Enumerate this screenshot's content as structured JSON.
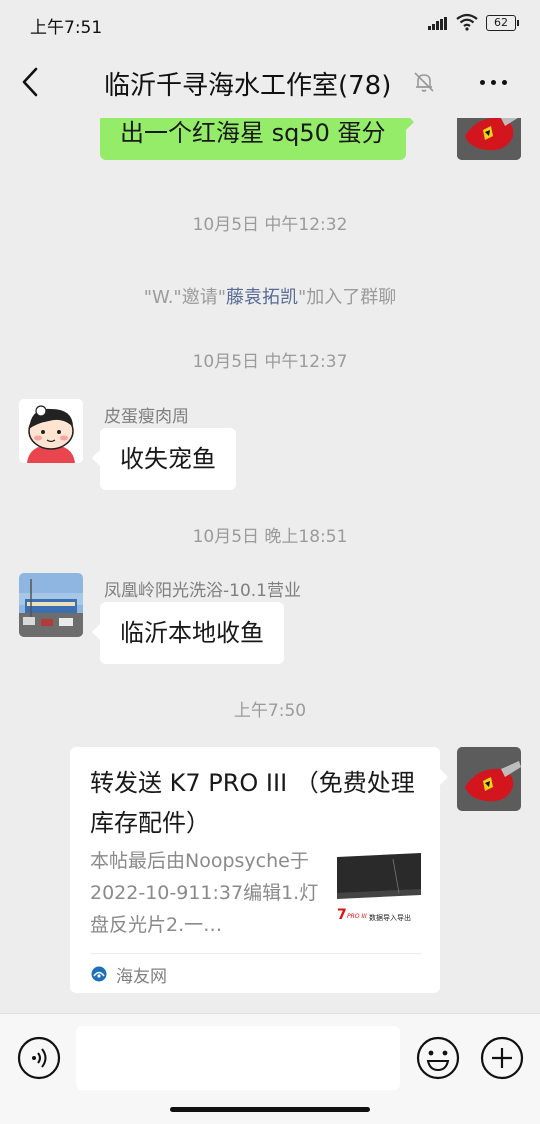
{
  "status_bar": {
    "time": "上午7:51",
    "battery": "62"
  },
  "nav": {
    "title": "临沂千寻海水工作室(78)"
  },
  "messages": {
    "top_self_text": "出一个红海星 sq50 蛋分",
    "ts1": "10月5日 中午12:32",
    "system_prefix": "\"W.\"邀请\"",
    "system_invitee": "藤袁拓凯",
    "system_suffix": "\"加入了群聊",
    "ts2": "10月5日 中午12:37",
    "msg1_sender": "皮蛋瘦肉周",
    "msg1_text": "收失宠鱼",
    "ts3": "10月5日 晚上18:51",
    "msg2_sender": "凤凰岭阳光洗浴-10.1营业",
    "msg2_text": "临沂本地收鱼",
    "ts4": "上午7:50",
    "card_title": "转发送 K7 PRO III （免费处理库存配件）",
    "card_desc": "本帖最后由Noopsyche于2022-10-911:37编辑1.灯盘反光片2.一…",
    "card_thumb_text1": "7",
    "card_thumb_text2": "PRO III",
    "card_thumb_text3": "数据导入导出",
    "card_source": "海友网"
  },
  "input": {
    "placeholder": ""
  },
  "colors": {
    "self_bubble": "#95ec69",
    "link": "#576b95",
    "background": "#ededed"
  }
}
